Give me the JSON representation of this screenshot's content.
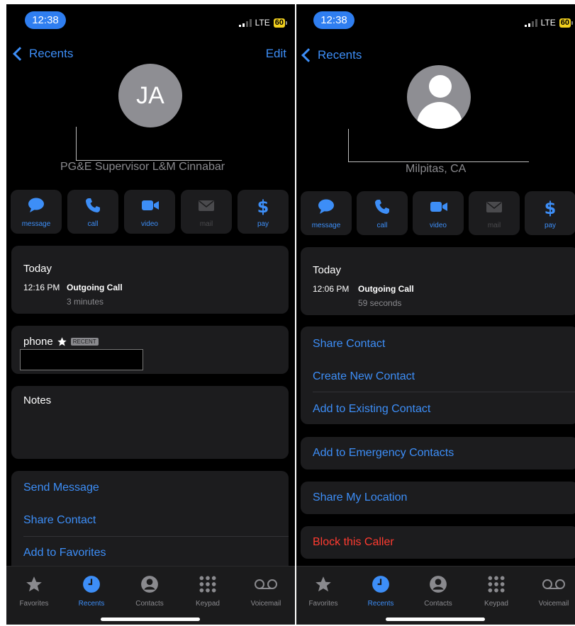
{
  "left": {
    "status": {
      "time": "12:38",
      "network": "LTE",
      "battery": "60"
    },
    "nav": {
      "back_label": "Recents",
      "edit_label": "Edit"
    },
    "contact": {
      "initials": "JA",
      "subtitle": "PG&E Supervisor L&M Cinnabar"
    },
    "actions": [
      {
        "label": "message",
        "icon": "message-icon"
      },
      {
        "label": "call",
        "icon": "phone-icon"
      },
      {
        "label": "video",
        "icon": "video-icon"
      },
      {
        "label": "mail",
        "icon": "mail-icon"
      },
      {
        "label": "pay",
        "icon": "dollar-icon"
      }
    ],
    "call_log": {
      "header": "Today",
      "time": "12:16 PM",
      "type": "Outgoing Call",
      "duration": "3 minutes"
    },
    "phone": {
      "label": "phone",
      "badge": "RECENT"
    },
    "notes": {
      "label": "Notes"
    },
    "options": [
      "Send Message",
      "Share Contact",
      "Add to Favorites"
    ]
  },
  "right": {
    "status": {
      "time": "12:38",
      "network": "LTE",
      "battery": "60"
    },
    "nav": {
      "back_label": "Recents"
    },
    "contact": {
      "subtitle": "Milpitas, CA"
    },
    "actions": [
      {
        "label": "message",
        "icon": "message-icon"
      },
      {
        "label": "call",
        "icon": "phone-icon"
      },
      {
        "label": "video",
        "icon": "video-icon"
      },
      {
        "label": "mail",
        "icon": "mail-icon"
      },
      {
        "label": "pay",
        "icon": "dollar-icon"
      }
    ],
    "call_log": {
      "header": "Today",
      "time": "12:06 PM",
      "type": "Outgoing Call",
      "duration": "59 seconds"
    },
    "options": [
      "Share Contact",
      "Create New Contact",
      "Add to Existing Contact"
    ],
    "emergency": "Add to Emergency Contacts",
    "location": "Share My Location",
    "block": "Block this Caller"
  },
  "tabbar": {
    "items": [
      {
        "label": "Favorites",
        "icon": "star-icon"
      },
      {
        "label": "Recents",
        "icon": "clock-icon"
      },
      {
        "label": "Contacts",
        "icon": "person-circle-icon"
      },
      {
        "label": "Keypad",
        "icon": "keypad-icon"
      },
      {
        "label": "Voicemail",
        "icon": "voicemail-icon"
      }
    ],
    "active": "Recents"
  },
  "colors": {
    "accent": "#3d8ef7",
    "destructive": "#ff3b30",
    "card": "#1c1c1e",
    "battery": "#f2d01e"
  }
}
